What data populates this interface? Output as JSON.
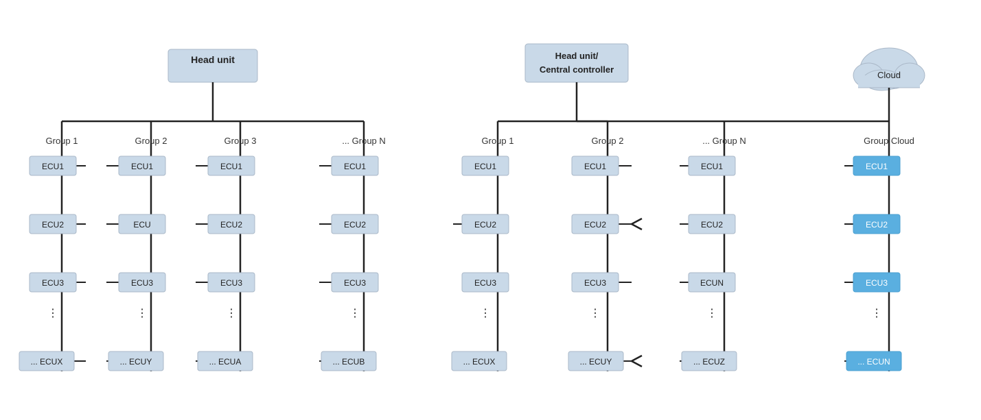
{
  "left": {
    "head_unit": "Head unit",
    "groups": [
      {
        "label": "Group 1",
        "ecus": [
          "ECU1",
          "ECU2",
          "ECU3",
          "⋮",
          "... ECUX"
        ]
      },
      {
        "label": "Group 2",
        "ecus": [
          "ECU1",
          "ECU",
          "ECU3",
          "⋮",
          "... ECUY"
        ]
      },
      {
        "label": "Group 3",
        "ecus": [
          "ECU1",
          "ECU2",
          "ECU3",
          "⋮",
          "... ECUA"
        ]
      },
      {
        "label": "... Group N",
        "ecus": [
          "ECU1",
          "ECU2",
          "ECU3",
          "⋮",
          "... ECUB"
        ]
      }
    ]
  },
  "right": {
    "head_unit": "Head unit/\nCentral controller",
    "cloud_label": "Cloud",
    "groups": [
      {
        "label": "Group 1",
        "ecus": [
          "ECU1",
          "ECU2",
          "ECU3",
          "⋮",
          "... ECUX"
        ],
        "gateway_arrows": [
          0,
          2
        ]
      },
      {
        "label": "Group 2",
        "ecus": [
          "ECU1",
          "ECU2",
          "ECU3",
          "⋮",
          "... ECUY"
        ],
        "split_arrows": [
          1,
          4
        ]
      },
      {
        "label": "... Group N",
        "ecus": [
          "ECU1",
          "ECU2",
          "ECUN",
          "⋮",
          "... ECUZ"
        ]
      },
      {
        "label": "Group Cloud",
        "ecus": [
          "ECU1",
          "ECU2",
          "ECU3",
          "⋮",
          "... ECUN"
        ],
        "blue": true
      }
    ]
  }
}
